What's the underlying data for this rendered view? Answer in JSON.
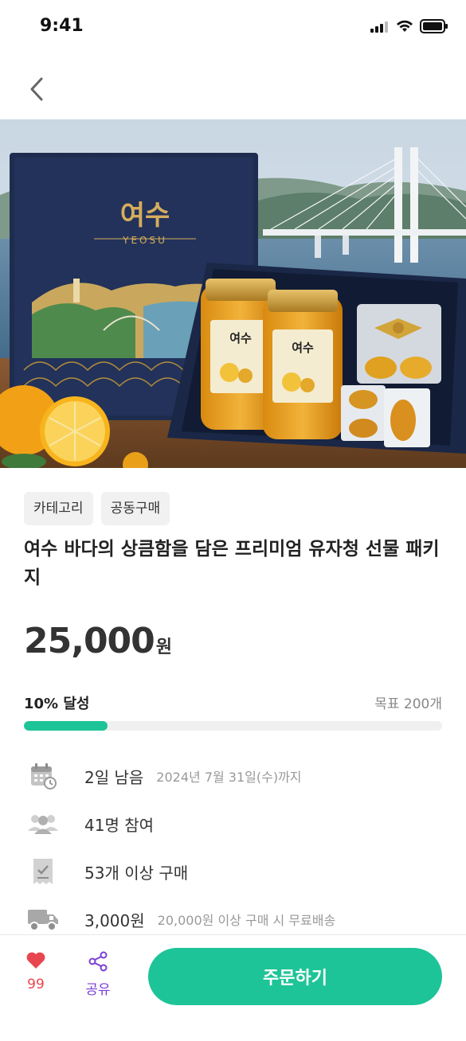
{
  "status_bar": {
    "time": "9:41"
  },
  "nav": {
    "back_icon": "chevron-left-icon"
  },
  "product": {
    "tags": [
      "카테고리",
      "공동구매"
    ],
    "title": "여수 바다의 상큼함을 담은 프리미엄 유자청 선물 패키지",
    "price": "25,000",
    "price_unit": "원",
    "box_brand": "여수",
    "box_brand_en": "YEOSU",
    "jar_label": "여수"
  },
  "progress": {
    "achieved_label": "10% 달성",
    "percent": 20,
    "goal_label": "목표 200개"
  },
  "info": {
    "deadline_main": "2일 남음",
    "deadline_sub": "2024년 7월 31일(수)까지",
    "participants": "41명 참여",
    "min_purchase": "53개 이상 구매",
    "shipping_fee": "3,000원",
    "shipping_sub": "20,000원 이상 구매 시 무료배송"
  },
  "bottom": {
    "like_count": "99",
    "share_label": "공유",
    "order_label": "주문하기"
  },
  "colors": {
    "accent": "#1dc497",
    "heart": "#e8464f",
    "share": "#7b3fd6"
  }
}
